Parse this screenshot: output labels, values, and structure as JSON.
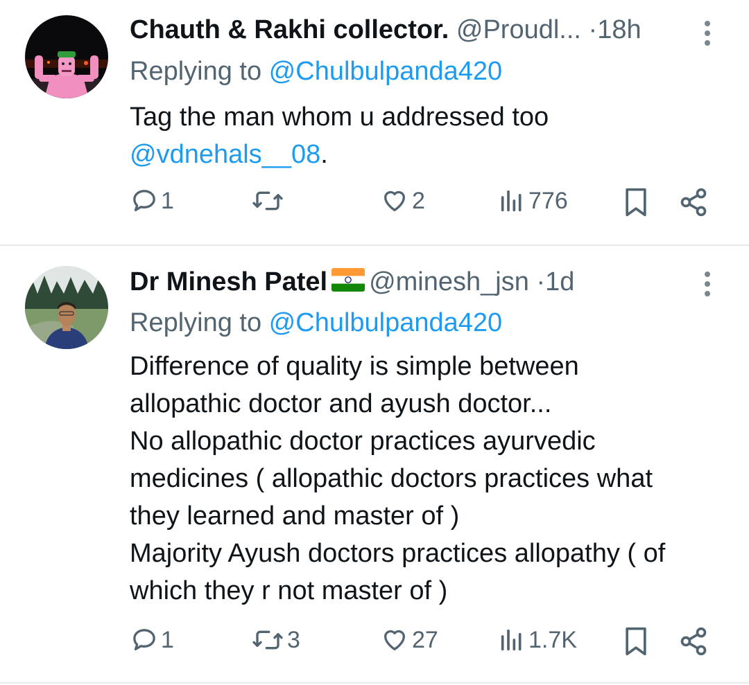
{
  "tweets": [
    {
      "author_name": "Chauth & Rakhi collector.",
      "handle": "@Proudl...",
      "separator": "·",
      "time": "18h",
      "replying_prefix": "Replying to ",
      "replying_to": "@Chulbulpanda420",
      "text_line1": "Tag the man whom u addressed too",
      "mention": "@vdnehals__08",
      "mention_suffix": ".",
      "replies": "1",
      "retweets": "",
      "likes": "2",
      "views": "776"
    },
    {
      "author_name": "Dr Minesh Patel",
      "flag": "india-flag-emoji",
      "handle": "@minesh_jsn",
      "separator": "·",
      "time": "1d",
      "replying_prefix": "Replying to ",
      "replying_to": "@Chulbulpanda420",
      "lines": [
        "Difference of quality is simple between",
        "allopathic doctor and ayush doctor...",
        "No allopathic doctor practices ayurvedic",
        "medicines ( allopathic doctors practices what",
        "they learned and master of )",
        "Majority Ayush doctors practices allopathy ( of",
        "which they r not master of )"
      ],
      "replies": "1",
      "retweets": "3",
      "likes": "27",
      "views": "1.7K"
    }
  ],
  "icons": {
    "reply": "reply-icon",
    "retweet": "retweet-icon",
    "like": "heart-icon",
    "views": "views-icon",
    "bookmark": "bookmark-icon",
    "share": "share-icon",
    "more": "more-vertical-icon"
  },
  "colors": {
    "link": "#1d9bf0",
    "secondary": "#536471",
    "text": "#0f1419",
    "divider": "#e7e9ea"
  }
}
